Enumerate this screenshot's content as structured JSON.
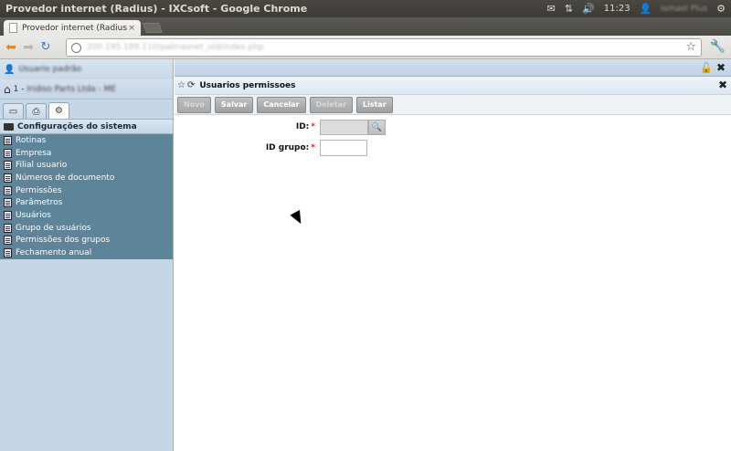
{
  "os": {
    "window_title": "Provedor internet (Radius) - IXCsoft - Google Chrome",
    "clock": "11:23",
    "user": "Ismael Plus"
  },
  "browser": {
    "tab_title": "Provedor internet (Radius",
    "tab_close": "×",
    "url": "200.195.189.110/palmasnet_old/index.php"
  },
  "sidebar": {
    "user": "Usuario padrão",
    "company_prefix": "1 -",
    "company": "Iridiso Parts Ltda - ME",
    "section_title": "Configurações do sistema",
    "items": [
      {
        "label": "Rotinas"
      },
      {
        "label": "Empresa"
      },
      {
        "label": "Filial usuario"
      },
      {
        "label": "Números de documento"
      },
      {
        "label": "Permissões"
      },
      {
        "label": "Parâmetros"
      },
      {
        "label": "Usuários"
      },
      {
        "label": "Grupo de usuários"
      },
      {
        "label": "Permissões dos grupos"
      },
      {
        "label": "Fechamento anual"
      }
    ]
  },
  "panel": {
    "title": "Usuarios permissoes",
    "buttons": {
      "novo": "Novo",
      "salvar": "Salvar",
      "cancelar": "Cancelar",
      "deletar": "Deletar",
      "listar": "Listar"
    },
    "fields": {
      "id_label": "ID:",
      "id_value": "",
      "id_grupo_label": "ID grupo:",
      "id_grupo_value": "",
      "required_mark": "*"
    }
  }
}
